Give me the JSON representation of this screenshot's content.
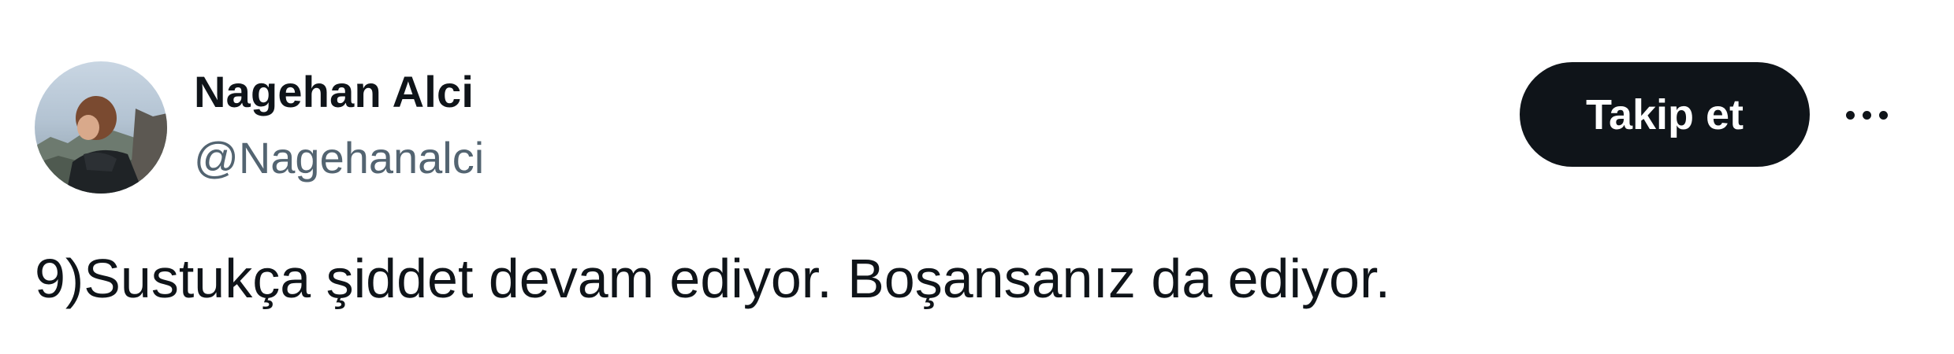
{
  "author": {
    "display_name": "Nagehan Alci",
    "handle": "@Nagehanalci"
  },
  "actions": {
    "follow_label": "Takip et",
    "more_icon": "more-horizontal-icon"
  },
  "tweet": {
    "text": "9)Sustukça şiddet devam ediyor. Boşansanız da ediyor."
  },
  "colors": {
    "text_primary": "#0f1419",
    "text_secondary": "#536471",
    "follow_button_bg": "#0f1419",
    "background": "#ffffff"
  }
}
